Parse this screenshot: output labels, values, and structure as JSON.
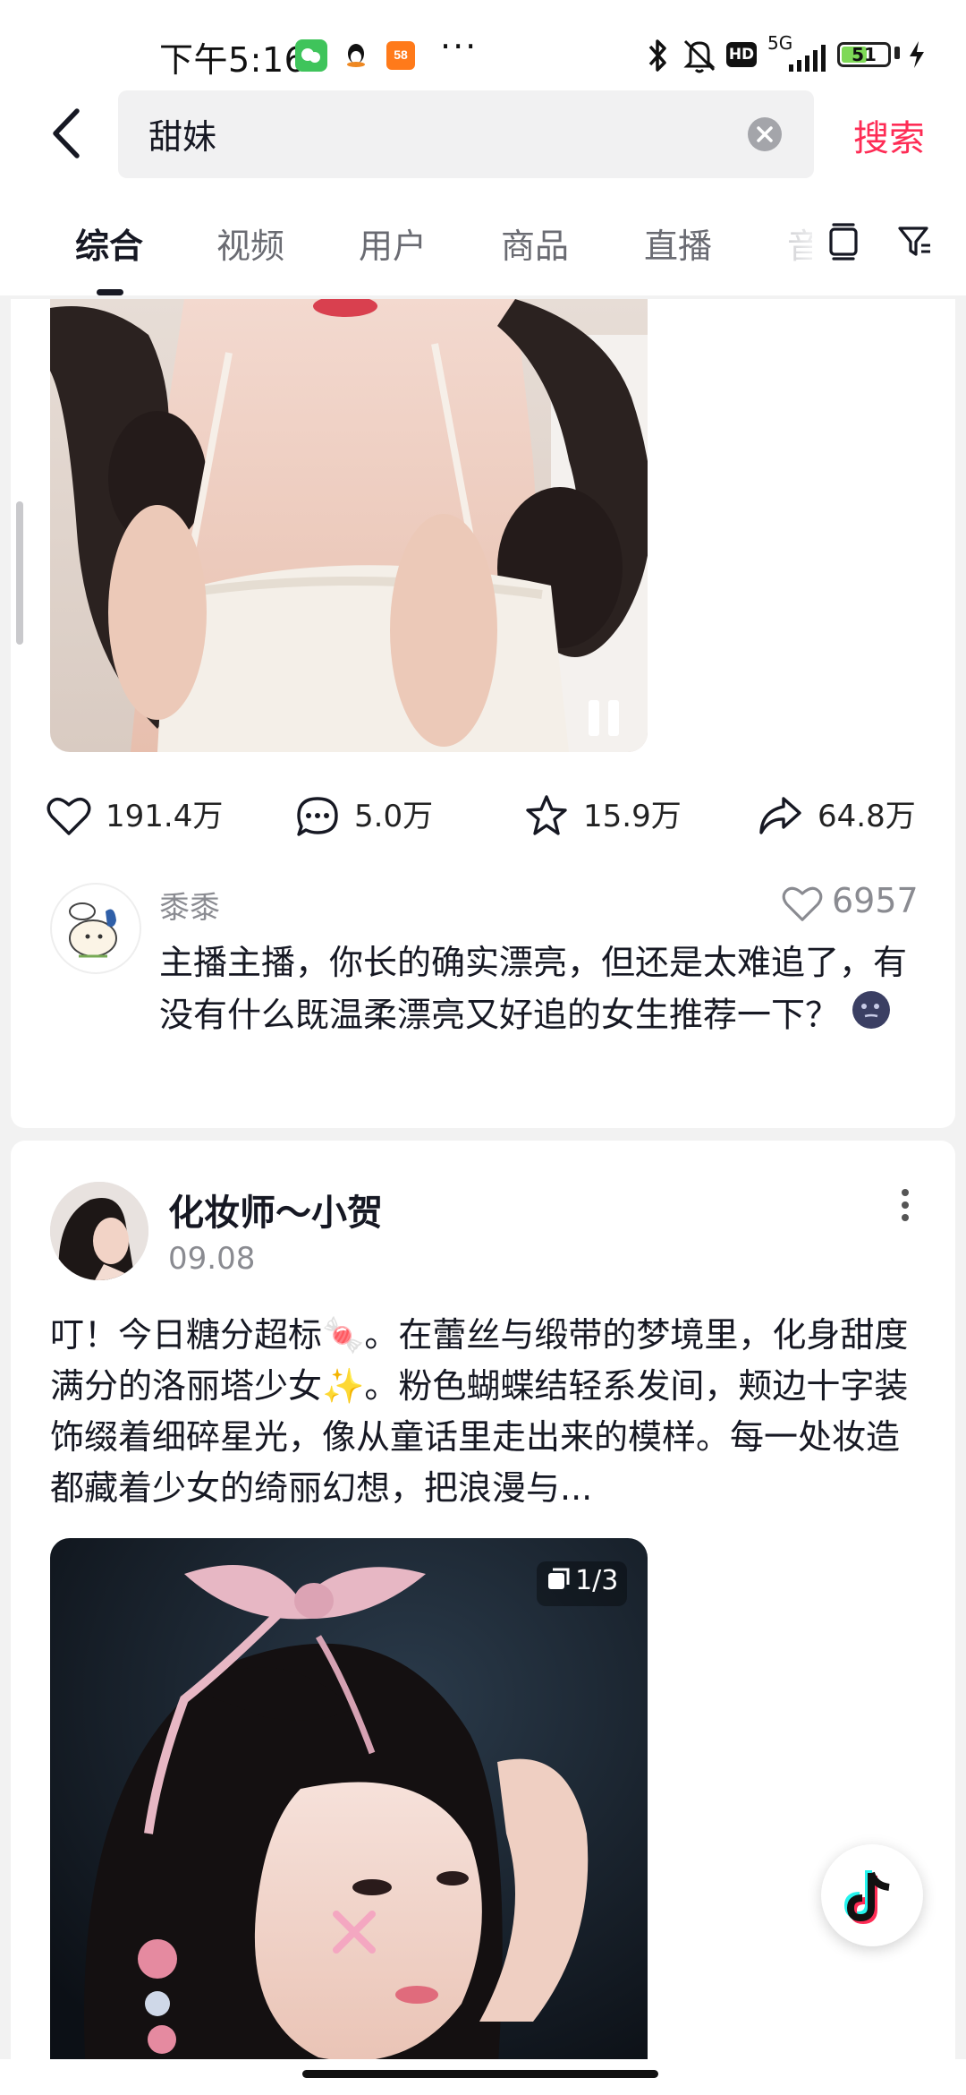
{
  "status_bar": {
    "time": "下午5:16",
    "network": "5G",
    "battery": "51"
  },
  "search": {
    "query": "甜妹",
    "submit_label": "搜索"
  },
  "tabs": [
    {
      "label": "综合"
    },
    {
      "label": "视频"
    },
    {
      "label": "用户"
    },
    {
      "label": "商品"
    },
    {
      "label": "直播"
    },
    {
      "label": "音"
    }
  ],
  "video_post": {
    "likes": "191.4万",
    "comments": "5.0万",
    "favorites": "15.9万",
    "shares": "64.8万",
    "top_comment": {
      "author": "黍黍",
      "likes": "6957",
      "text": "主播主播，你长的确实漂亮，但还是太难追了，有没有什么既温柔漂亮又好追的女生推荐一下？"
    }
  },
  "image_post": {
    "author": "化妆师～小贺",
    "date": "09.08",
    "text": "叮！今日糖分超标🍬。在蕾丝与缎带的梦境里，化身甜度满分的洛丽塔少女✨。粉色蝴蝶结轻系发间，颊边十字装饰缀着细碎星光，像从童话里走出来的模样。每一处妆造都藏着少女的绮丽幻想，把浪漫与...",
    "image_counter": "1/3"
  },
  "colors": {
    "accent": "#fe2c55",
    "text": "#161823",
    "muted": "#8a8b91"
  }
}
